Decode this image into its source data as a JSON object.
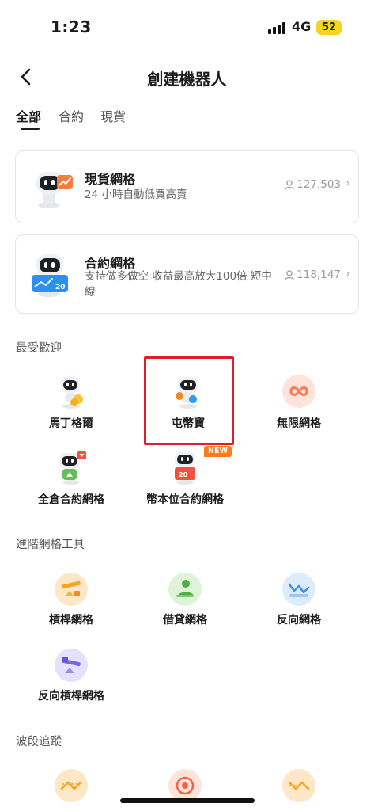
{
  "status_bar": {
    "time": "1:23",
    "network": "4G",
    "battery": "52"
  },
  "header": {
    "title": "創建機器人"
  },
  "tabs": [
    {
      "label": "全部",
      "active": true
    },
    {
      "label": "合約",
      "active": false
    },
    {
      "label": "現貨",
      "active": false
    }
  ],
  "cards": [
    {
      "title": "現貨網格",
      "description": "24 小時自動低買高賣",
      "users": "127,503",
      "icon": "robot-spot-grid-icon"
    },
    {
      "title": "合約網格",
      "description": "支持做多做空 收益最高放大100倍 短中線",
      "users": "118,147",
      "icon": "robot-futures-grid-icon"
    }
  ],
  "sections": {
    "popular": {
      "heading": "最受歡迎",
      "items": [
        {
          "label": "馬丁格爾",
          "icon": "robot-martingale-icon"
        },
        {
          "label": "屯幣寶",
          "icon": "robot-coin-hoard-icon"
        },
        {
          "label": "無限網格",
          "icon": "infinity-icon"
        },
        {
          "label": "全倉合約網格",
          "icon": "robot-cross-margin-icon"
        },
        {
          "label": "幣本位合約網格",
          "icon": "robot-coin-margined-icon",
          "badge": "NEW"
        }
      ]
    },
    "advanced": {
      "heading": "進階網格工具",
      "items": [
        {
          "label": "槓桿網格",
          "icon": "leverage-grid-icon"
        },
        {
          "label": "借貸網格",
          "icon": "loan-grid-icon"
        },
        {
          "label": "反向網格",
          "icon": "reverse-grid-icon"
        },
        {
          "label": "反向槓桿網格",
          "icon": "reverse-leverage-grid-icon"
        }
      ]
    },
    "swing": {
      "heading": "波段追蹤"
    }
  },
  "colors": {
    "highlight": "#e11d2b",
    "badge": "#ff7a1a",
    "orange_soft": "#fde7c7",
    "green_soft": "#dff3d8",
    "blue_soft": "#dcecfb",
    "purple_soft": "#e5e0fb",
    "peach_soft": "#fde3da"
  }
}
